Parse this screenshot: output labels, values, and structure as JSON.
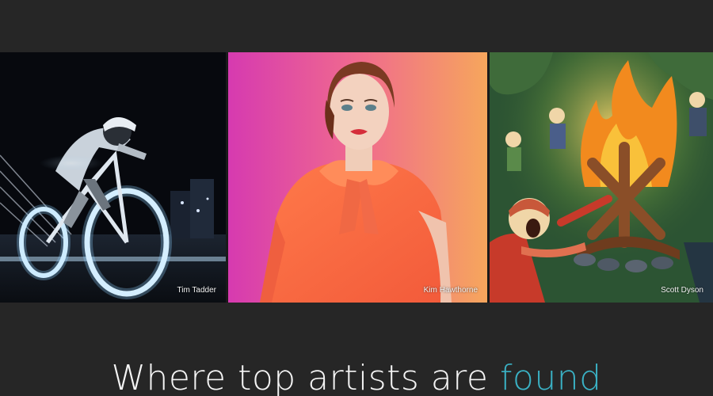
{
  "gallery": {
    "items": [
      {
        "credit": "Tim Tadder",
        "subject": "cyclist-light-trail-photo"
      },
      {
        "credit": "Kim Hawthorne",
        "subject": "fashion-portrait-photo"
      },
      {
        "credit": "Scott Dyson",
        "subject": "campfire-cartoon-illustration"
      }
    ]
  },
  "tagline": {
    "main": "Where top artists are ",
    "accent": "found"
  },
  "colors": {
    "background": "#262626",
    "accent": "#3ab1c4",
    "text": "#f4f4f4"
  }
}
